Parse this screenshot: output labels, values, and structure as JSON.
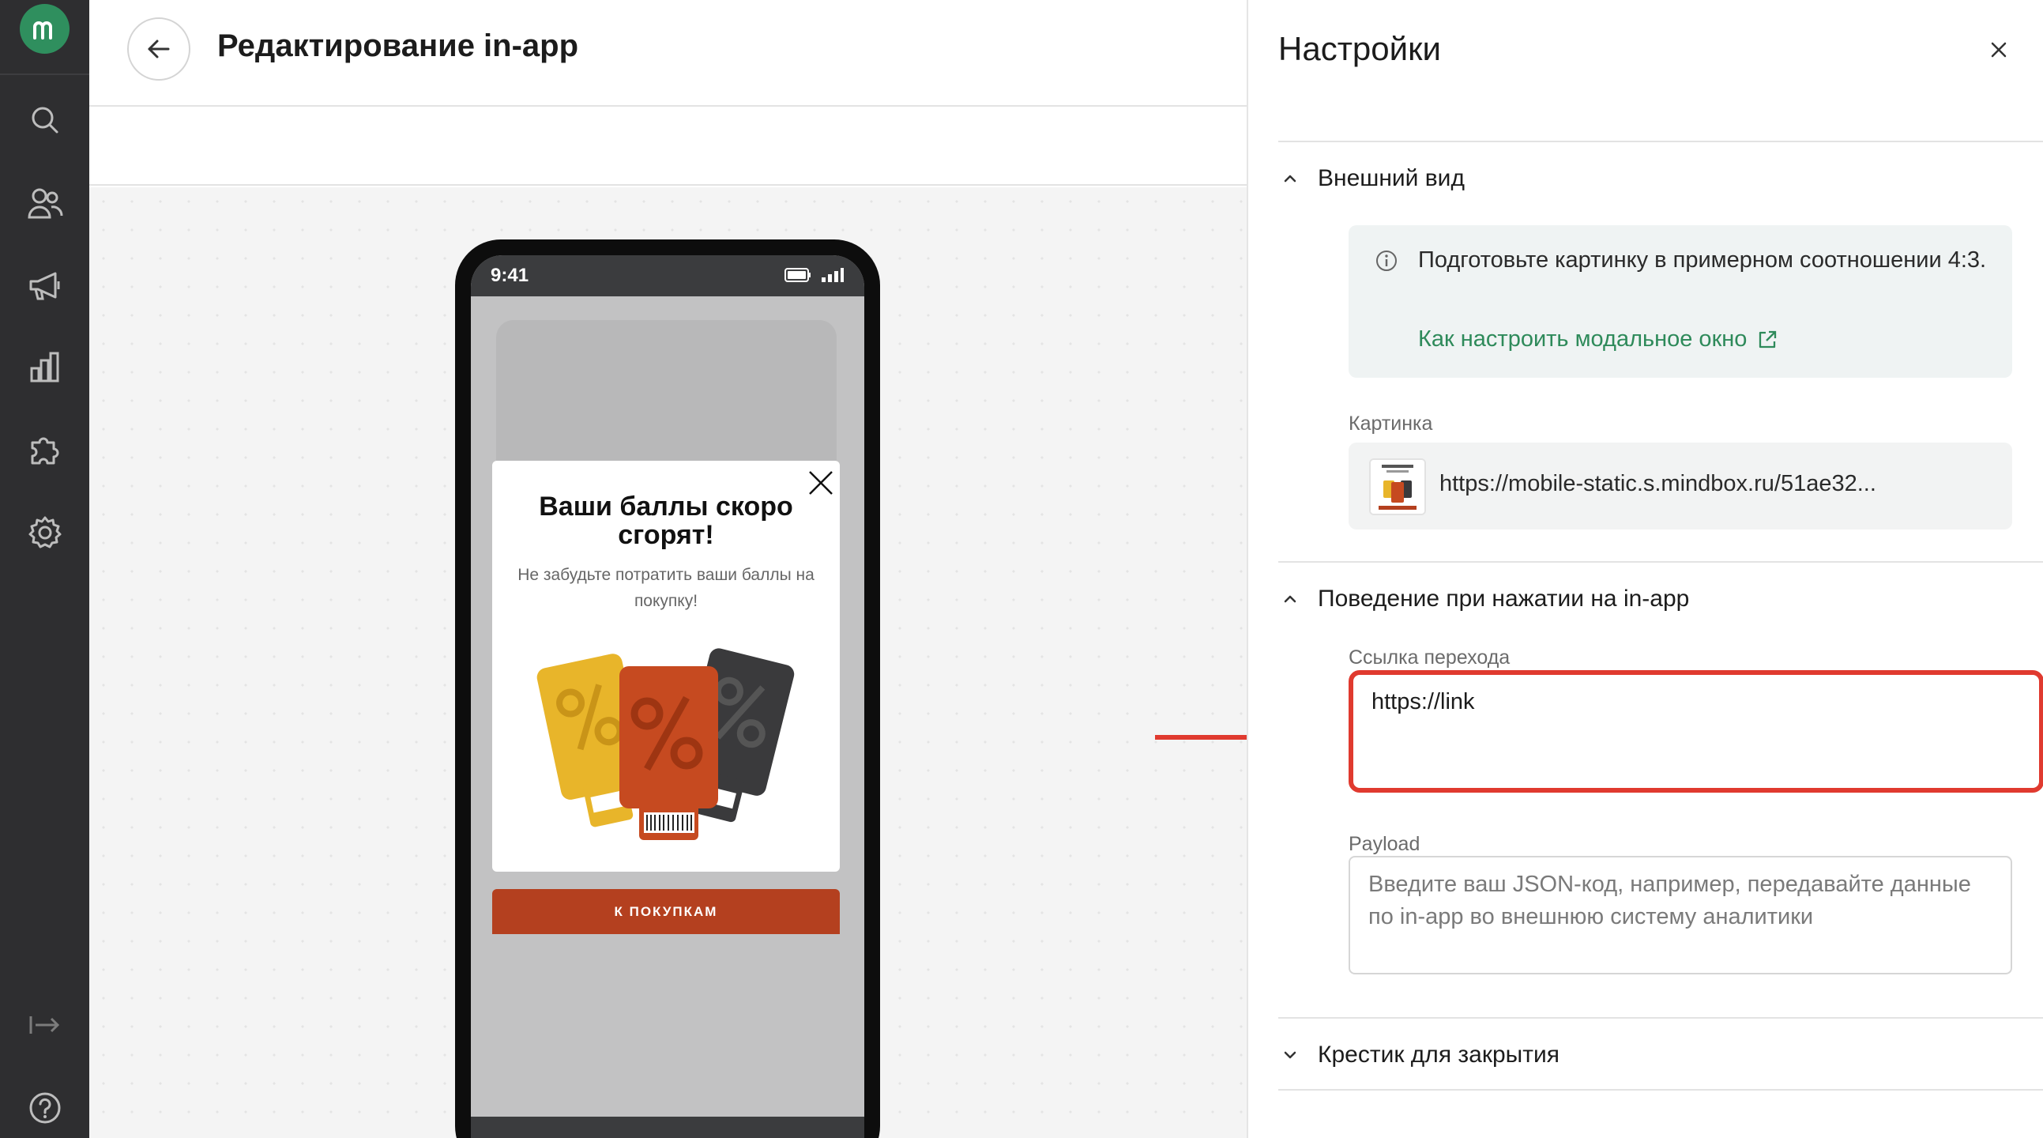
{
  "app": {
    "brand_color": "#2f8f5e",
    "rail_color": "#2e2e30",
    "accent_red": "#e03a2f"
  },
  "rail": {
    "logo_letter": "m",
    "icons": [
      "search-icon",
      "users-icon",
      "megaphone-icon",
      "analytics-icon",
      "integrations-icon",
      "settings-icon",
      "collapse-icon",
      "help-icon"
    ]
  },
  "editor": {
    "title": "Редактирование in-app"
  },
  "phone": {
    "time": "9:41",
    "modal_title": "Ваши баллы скоро сгорят!",
    "modal_text": "Не забудьте потратить ваши баллы на покупку!",
    "cta_label": "К ПОКУПКАМ",
    "cta_color": "#b4401f"
  },
  "settings": {
    "title": "Настройки",
    "appearance": {
      "label": "Внешний вид",
      "info_text": "Подготовьте картинку в примерном соотношении 4:3.",
      "info_link": "Как настроить модальное окно",
      "image_label": "Картинка",
      "image_url": "https://mobile-static.s.mindbox.ru/51ae32..."
    },
    "behavior": {
      "label": "Поведение при нажатии на in-app",
      "link_label": "Ссылка перехода",
      "link_value": "https://link",
      "payload_label": "Payload",
      "payload_placeholder": "Введите ваш JSON-код, например, передавайте данные по in-app во внешнюю систему аналитики"
    },
    "close_cross": {
      "label": "Крестик для закрытия"
    }
  }
}
